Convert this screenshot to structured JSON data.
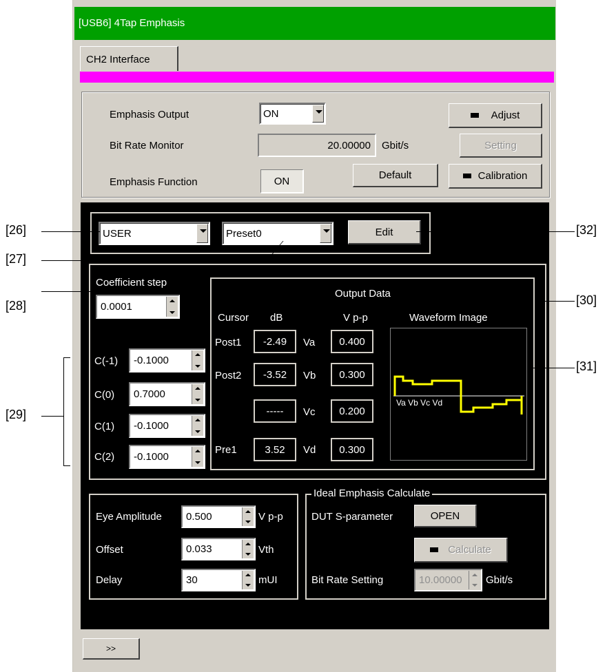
{
  "window": {
    "title": "[USB6] 4Tap Emphasis",
    "tab": "CH2 Interface"
  },
  "top": {
    "emphasis_output_label": "Emphasis Output",
    "emphasis_output_value": "ON",
    "bit_rate_monitor_label": "Bit Rate Monitor",
    "bit_rate_value": "20.00000",
    "bit_rate_unit": "Gbit/s",
    "emphasis_function_label": "Emphasis Function",
    "emphasis_function_value": "ON",
    "adjust_label": "Adjust",
    "setting_label": "Setting",
    "default_label": "Default",
    "calibration_label": "Calibration"
  },
  "selector": {
    "mode": "USER",
    "preset": "Preset0",
    "edit_label": "Edit"
  },
  "coeff": {
    "step_label": "Coefficient step",
    "step_value": "0.0001",
    "items": [
      {
        "label": "C(-1)",
        "value": "-0.1000"
      },
      {
        "label": "C(0)",
        "value": "0.7000"
      },
      {
        "label": "C(1)",
        "value": "-0.1000"
      },
      {
        "label": "C(2)",
        "value": "-0.1000"
      }
    ]
  },
  "output": {
    "title": "Output Data",
    "col_cursor": "Cursor",
    "col_db": "dB",
    "col_vpp": "V p-p",
    "col_wave": "Waveform Image",
    "rows": [
      {
        "cursor": "Post1",
        "db": "-2.49",
        "v": "Va",
        "vpp": "0.400"
      },
      {
        "cursor": "Post2",
        "db": "-3.52",
        "v": "Vb",
        "vpp": "0.300"
      },
      {
        "cursor": "",
        "db": "-----",
        "v": "Vc",
        "vpp": "0.200"
      },
      {
        "cursor": "Pre1",
        "db": "3.52",
        "v": "Vd",
        "vpp": "0.300"
      }
    ],
    "wave_labels": "Va Vb Vc Vd",
    "wave_color": "#ffff00"
  },
  "eye": {
    "amplitude_label": "Eye Amplitude",
    "amplitude_value": "0.500",
    "amplitude_unit": "V p-p",
    "offset_label": "Offset",
    "offset_value": "0.033",
    "offset_unit": "Vth",
    "delay_label": "Delay",
    "delay_value": "30",
    "delay_unit": "mUI"
  },
  "ideal": {
    "title": "Ideal Emphasis Calculate",
    "dut_label": "DUT S-parameter",
    "open_label": "OPEN",
    "calculate_label": "Calculate",
    "bitrate_label": "Bit Rate Setting",
    "bitrate_value": "10.00000",
    "bitrate_unit": "Gbit/s"
  },
  "footer": {
    "more_label": ">>"
  },
  "callouts": {
    "c26": "[26]",
    "c27": "[27]",
    "c28": "[28]",
    "c29": "[29]",
    "c30": "[30]",
    "c31": "[31]",
    "c32": "[32]"
  },
  "colors": {
    "titlebar": "#00a000",
    "strip": "#ff00ff",
    "panel": "#000000",
    "face": "#d4d0c8"
  }
}
